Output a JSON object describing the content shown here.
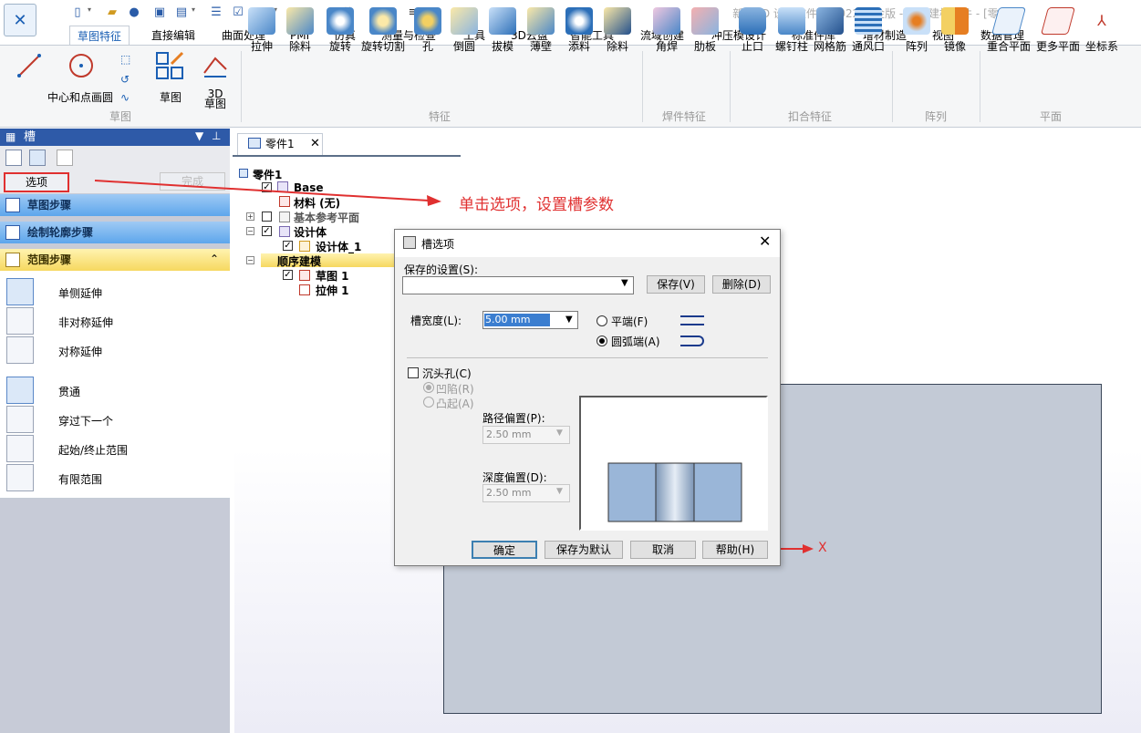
{
  "window": {
    "title": "新迪3D 设计软件© 2022 白金版 - 顺序建模零件 - [零件1]"
  },
  "menu_tabs": [
    "草图特征",
    "直接编辑",
    "曲面处理",
    "PMI",
    "仿真",
    "测量与检查",
    "工具",
    "3D云盘",
    "智能工具",
    "流域创建",
    "冲压模设计",
    "标准件库",
    "增材制造",
    "视图",
    "数据管理"
  ],
  "ribbon": {
    "sketch_group": {
      "circle_label": "中心和点画圆",
      "sketch_label": "草图",
      "sketch3d_label": "3D 草图",
      "group": "草图"
    },
    "features": [
      "拉伸",
      "除料",
      "旋转",
      "旋转切割",
      "孔",
      "倒圆",
      "拔模",
      "薄壁",
      "添料",
      "除料"
    ],
    "features_group": "特征",
    "weld": [
      "角焊",
      "肋板"
    ],
    "weld_group": "焊件特征",
    "snap": [
      "止口",
      "螺钉柱",
      "网格筋",
      "通风口"
    ],
    "snap_group": "扣合特征",
    "pattern": [
      "阵列",
      "镜像"
    ],
    "pattern_group": "阵列",
    "plane": [
      "重合平面",
      "更多平面",
      "坐标系"
    ],
    "plane_group": "平面"
  },
  "left_panel": {
    "title": "槽",
    "options_button": "选项",
    "done_button": "完成",
    "steps": [
      "草图步骤",
      "绘制轮廓步骤",
      "范围步骤"
    ],
    "range_options": [
      "单侧延伸",
      "非对称延伸",
      "对称延伸",
      "贯通",
      "穿过下一个",
      "起始/终止范围",
      "有限范围"
    ]
  },
  "document": {
    "tab_label": "零件1",
    "tree": [
      "零件1",
      "Base",
      "材料 (无)",
      "基本参考平面",
      "设计体",
      "设计体_1",
      "顺序建模",
      "草图 1",
      "拉伸 1"
    ]
  },
  "annotation": "单击选项，设置槽参数",
  "dialog": {
    "title": "槽选项",
    "saved_settings_label": "保存的设置(S):",
    "saved_settings_value": "",
    "save_button": "保存(V)",
    "delete_button": "删除(D)",
    "width_label": "槽宽度(L):",
    "width_value": "5.00 mm",
    "flat_end": "平端(F)",
    "arc_end": "圆弧端(A)",
    "countersink": "沉头孔(C)",
    "recessed": "凹陷(R)",
    "raised": "凸起(A)",
    "path_offset_label": "路径偏置(P):",
    "path_offset_value": "2.50 mm",
    "depth_offset_label": "深度偏置(D):",
    "depth_offset_value": "2.50 mm",
    "ok_button": "确定",
    "save_default_button": "保存为默认",
    "cancel_button": "取消",
    "help_button": "帮助(H)"
  },
  "axis_label": "X",
  "colors": {
    "accent": "#1a5fb4",
    "annotation": "#e03030",
    "step_blue": "#5da6ec",
    "step_yellow": "#f6d860"
  }
}
